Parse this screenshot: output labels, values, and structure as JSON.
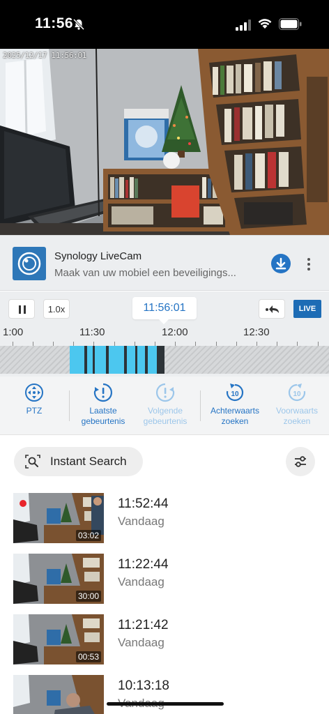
{
  "status_bar": {
    "time": "11:56"
  },
  "video": {
    "timestamp": "2025/12/17 11:56:01"
  },
  "banner": {
    "title": "Synology LiveCam",
    "subtitle": "Maak van uw mobiel een beveiligings..."
  },
  "controls": {
    "speed": "1.0x",
    "current_time": "11:56:01",
    "live_label": "LIVE"
  },
  "timeline": {
    "ticks": [
      "1:00",
      "11:30",
      "12:00",
      "12:30"
    ]
  },
  "actions": [
    {
      "label": "PTZ",
      "state": "active",
      "icon": "ptz-icon"
    },
    {
      "label": "Laatste gebeurtenis",
      "state": "active",
      "icon": "alert-icon"
    },
    {
      "label": "Volgende gebeurtenis",
      "state": "disabled",
      "icon": "next-event-icon"
    },
    {
      "label": "Achterwaarts zoeken",
      "state": "active",
      "icon": "rewind-10-icon"
    },
    {
      "label": "Voorwaarts zoeken",
      "state": "disabled",
      "icon": "forward-10-icon"
    }
  ],
  "search": {
    "label": "Instant Search"
  },
  "events": [
    {
      "time": "11:52:44",
      "day": "Vandaag",
      "duration": "03:02",
      "recording": true
    },
    {
      "time": "11:22:44",
      "day": "Vandaag",
      "duration": "30:00",
      "recording": false
    },
    {
      "time": "11:21:42",
      "day": "Vandaag",
      "duration": "00:53",
      "recording": false
    },
    {
      "time": "10:13:18",
      "day": "Vandaag",
      "duration": "",
      "recording": false
    }
  ],
  "colors": {
    "accent": "#2574c4",
    "recording": "#4cc7ef",
    "live": "#1d6cb5"
  }
}
